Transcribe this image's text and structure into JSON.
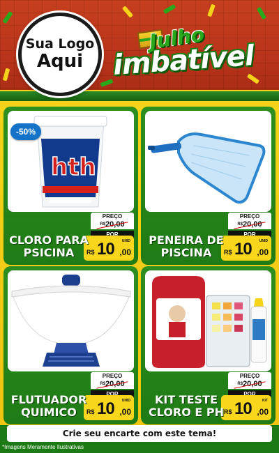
{
  "header": {
    "logo_line1": "Sua Logo",
    "logo_line2": "Aqui",
    "campaign_top": "Julho",
    "campaign_bottom": "imbatível"
  },
  "products": [
    {
      "name_line1": "CLORO PARA",
      "name_line2": "PSICINA",
      "badge": "-50%",
      "price_label": "PREÇO",
      "old_currency": "R$",
      "old_price": "20,00",
      "por_label": "POR",
      "currency": "R$",
      "price_int": "10",
      "price_dec": ",00",
      "unit": "UNID",
      "image": "chlorine-bucket-icon",
      "brand_text": "hth"
    },
    {
      "name_line1": "PENEIRA DE",
      "name_line2": "PISCINA",
      "price_label": "PREÇO",
      "old_currency": "R$",
      "old_price": "20,00",
      "por_label": "POR",
      "currency": "R$",
      "price_int": "10",
      "price_dec": ",00",
      "unit": "UNID",
      "image": "pool-skimmer-net-icon"
    },
    {
      "name_line1": "FLUTUADOR",
      "name_line2": "QUIMICO",
      "price_label": "PREÇO",
      "old_currency": "R$",
      "old_price": "20,00",
      "por_label": "POR",
      "currency": "R$",
      "price_int": "10",
      "price_dec": ",00",
      "unit": "UNID",
      "image": "chemical-floater-icon"
    },
    {
      "name_line1": "KIT TESTE",
      "name_line2": "CLORO E PH",
      "price_label": "PREÇO",
      "old_currency": "R$",
      "old_price": "20,00",
      "por_label": "POR",
      "currency": "R$",
      "price_int": "10",
      "price_dec": ",00",
      "unit": "KIT",
      "image": "test-kit-icon"
    }
  ],
  "footer": {
    "cta": "Crie seu encarte com este tema!",
    "disclaimer": "*Imagens Meramente Ilustrativas"
  },
  "colors": {
    "header_red": "#b8331a",
    "card_green": "#1f7b15",
    "accent_yellow": "#f5d31a",
    "badge_blue": "#1473c8"
  }
}
